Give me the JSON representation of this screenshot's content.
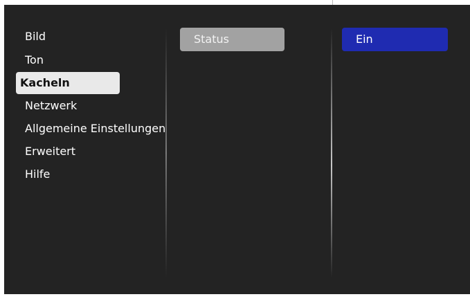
{
  "menu": {
    "items": [
      {
        "label": "Bild"
      },
      {
        "label": "Ton"
      },
      {
        "label": "Kacheln",
        "selected": true
      },
      {
        "label": "Netzwerk"
      },
      {
        "label": "Allgemeine Einstellungen"
      },
      {
        "label": "Erweitert"
      },
      {
        "label": "Hilfe"
      }
    ]
  },
  "submenu": {
    "item_label": "Status"
  },
  "value": {
    "label": "Ein"
  },
  "colors": {
    "background": "#232323",
    "selected_item_bg": "#e9e9e9",
    "submenu_item_bg": "#a2a2a2",
    "value_bg": "#1f2bb1"
  }
}
